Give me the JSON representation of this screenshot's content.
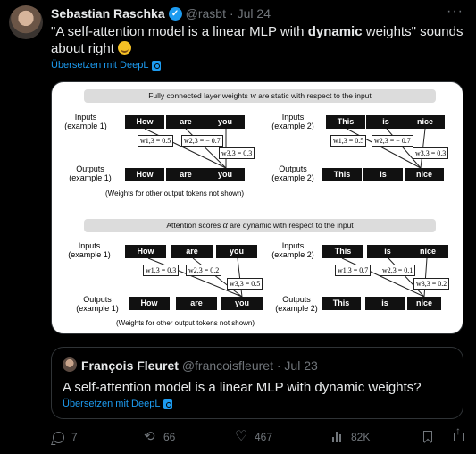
{
  "tweet": {
    "author_name": "Sebastian Raschka",
    "handle": "@rasbt",
    "separator": "·",
    "date": "Jul 24",
    "more": "···",
    "verified_icon": "check-badge-icon",
    "text_pre": "\"A self-attention model is a linear MLP with ",
    "text_bold": "dynamic",
    "text_post": " weights\" sounds about right",
    "emoji": "smiling-face-emoji",
    "translate": "Übersetzen mit DeepL"
  },
  "diagram": {
    "top_banner_pre": "Fully connected layer weights ",
    "top_banner_var": "w",
    "top_banner_post": " are static with respect to the input",
    "bottom_banner_pre": "Attention scores ",
    "bottom_banner_var": "α",
    "bottom_banner_post": " are dynamic with respect to the input",
    "inputs_ex1": "Inputs\n(example 1)",
    "inputs_ex2": "Inputs\n(example 2)",
    "outputs_ex1": "Outputs\n(example 1)",
    "outputs_ex2": "Outputs\n(example 2)",
    "example1_tokens": [
      "How",
      "are",
      "you"
    ],
    "example2_tokens": [
      "This",
      "is",
      "nice"
    ],
    "note": "(Weights for other output tokens not shown)",
    "fc_ex1_weights": [
      "w1,3 = 0.5",
      "w2,3 = − 0.7",
      "w3,3 = 0.3"
    ],
    "fc_ex2_weights": [
      "w1,3 = 0.5",
      "w2,3 = − 0.7",
      "w3,3 = 0.3"
    ],
    "attn_ex1_weights": [
      "w1,3 = 0.3",
      "w2,3 = 0.2",
      "w3,3 = 0.5"
    ],
    "attn_ex2_weights": [
      "w1,3 = 0.7",
      "w2,3 = 0.1",
      "w3,3 = 0.2"
    ]
  },
  "quote": {
    "author_name": "François Fleuret",
    "handle": "@francoisfleuret",
    "separator": "·",
    "date": "Jul 23",
    "text": "A self-attention model is a linear MLP with dynamic weights?",
    "translate": "Übersetzen mit DeepL"
  },
  "actions": {
    "replies": "7",
    "retweets": "66",
    "likes": "467",
    "views": "82K"
  },
  "colors": {
    "background": "#000000",
    "text": "#e7e9ea",
    "muted": "#71767b",
    "accent": "#1d9bf0"
  }
}
